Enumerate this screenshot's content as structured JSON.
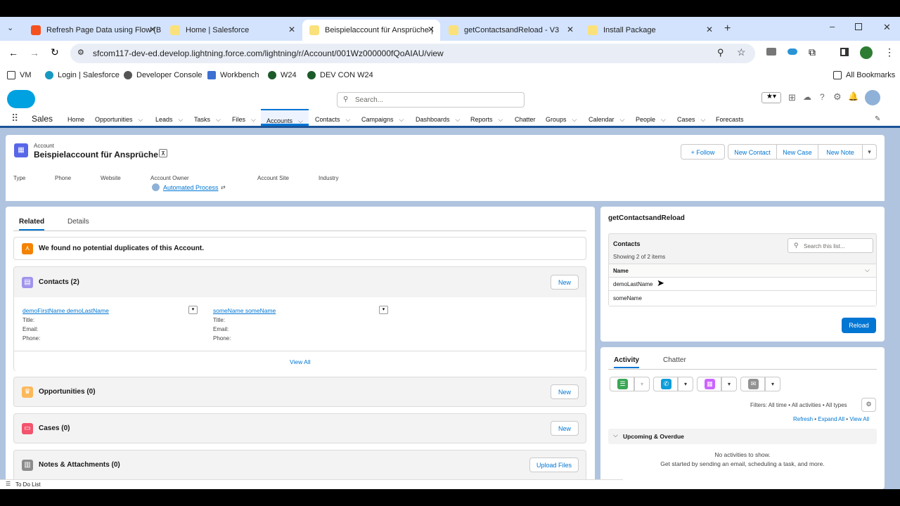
{
  "browser": {
    "tabs": [
      {
        "label": "Refresh Page Data using Flow (B",
        "color": "#f4511e"
      },
      {
        "label": "Home | Salesforce",
        "color": "#fbe17b"
      },
      {
        "label": "Beispielaccount für Ansprüche |",
        "color": "#fbe17b"
      },
      {
        "label": "getContactsandReload - V3",
        "color": "#fbe17b"
      },
      {
        "label": "Install Package",
        "color": "#fbe17b"
      }
    ],
    "url": "sfcom117-dev-ed.develop.lightning.force.com/lightning/r/Account/001Wz000000fQoAIAU/view",
    "bookmarks": [
      "VM",
      "Login | Salesforce",
      "Developer Console",
      "Workbench",
      "W24",
      "DEV CON W24"
    ],
    "all_bookmarks": "All Bookmarks"
  },
  "sf": {
    "search_placeholder": "Search...",
    "app_name": "Sales",
    "nav": [
      "Home",
      "Opportunities",
      "Leads",
      "Tasks",
      "Files",
      "Accounts",
      "Contacts",
      "Campaigns",
      "Dashboards",
      "Reports",
      "Chatter",
      "Groups",
      "Calendar",
      "People",
      "Cases",
      "Forecasts"
    ]
  },
  "record": {
    "object": "Account",
    "name": "Beispielaccount für Ansprüche",
    "actions": {
      "follow": "Follow",
      "new_contact": "New Contact",
      "new_case": "New Case",
      "new_note": "New Note"
    },
    "fields": {
      "type": "Type",
      "phone": "Phone",
      "website": "Website",
      "owner_label": "Account Owner",
      "owner": "Automated Process",
      "site": "Account Site",
      "industry": "Industry"
    }
  },
  "related": {
    "tabs": {
      "related": "Related",
      "details": "Details"
    },
    "duplicates": "We found no potential duplicates of this Account.",
    "contacts_title": "Contacts (2)",
    "new": "New",
    "contacts": [
      {
        "name": "demoFirstName demoLastName",
        "title": "Title:",
        "email": "Email:",
        "phone": "Phone:"
      },
      {
        "name": "someName someName",
        "title": "Title:",
        "email": "Email:",
        "phone": "Phone:"
      }
    ],
    "view_all": "View All",
    "opportunities": "Opportunities (0)",
    "cases": "Cases (0)",
    "notes": "Notes & Attachments (0)",
    "upload": "Upload Files"
  },
  "flow": {
    "title": "getContactsandReload",
    "list_title": "Contacts",
    "showing": "Showing 2 of 2 items",
    "search_placeholder": "Search this list...",
    "col_name": "Name",
    "rows": [
      "demoLastName",
      "someName"
    ],
    "reload": "Reload"
  },
  "activity": {
    "tabs": {
      "activity": "Activity",
      "chatter": "Chatter"
    },
    "filters": "Filters: All time • All activities • All types",
    "refresh": "Refresh",
    "expand": "Expand All",
    "view_all": "View All",
    "upcoming": "Upcoming & Overdue",
    "no_activities": "No activities to show.",
    "get_started": "Get started by sending an email, scheduling a task, and more."
  },
  "footer": {
    "todo": "To Do List"
  }
}
